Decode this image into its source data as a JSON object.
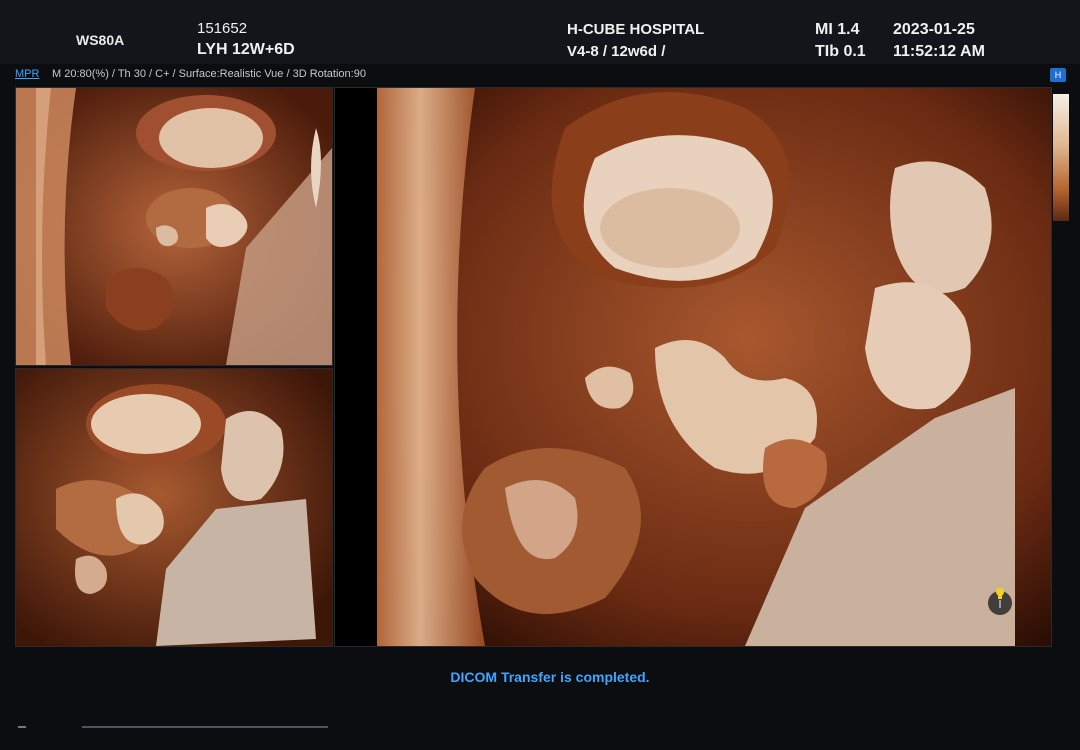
{
  "header": {
    "model": "WS80A",
    "patient_id": "151652",
    "patient_name": "LYH 12W+6D",
    "hospital": "H-CUBE HOSPITAL",
    "probe_info": "V4-8 / 12w6d /",
    "mi": "MI  1.4",
    "tib": "TIb 0.1",
    "date": "2023-01-25",
    "time": "11:52:12 AM"
  },
  "status_line": {
    "mode": "MPR",
    "params": "M 20:80(%) / Th 30 / C+ / Surface:Realistic Vue / 3D Rotation:90"
  },
  "indicator": {
    "label": "H"
  },
  "message": "DICOM Transfer is completed.",
  "colors": {
    "accent_blue": "#3fa6ff",
    "tissue_dark": "#3a1508",
    "tissue_mid": "#9a4a22",
    "tissue_light": "#e8c8a8"
  },
  "panes": [
    {
      "name": "mpr-top-left"
    },
    {
      "name": "mpr-bottom-left"
    },
    {
      "name": "3d-render-main"
    }
  ]
}
